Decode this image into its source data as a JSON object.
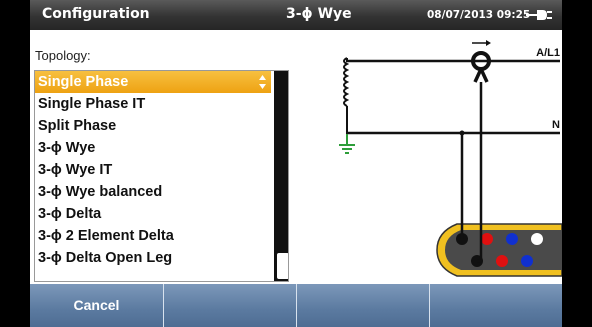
{
  "header": {
    "title": "Configuration",
    "mode": "3-ϕ Wye",
    "datetime": "08/07/2013 09:25",
    "power_icon": "plug-icon"
  },
  "topology": {
    "label": "Topology:",
    "selected_index": 0,
    "items": [
      "Single Phase",
      "Single Phase IT",
      "Split Phase",
      "3-ϕ Wye",
      "3-ϕ Wye IT",
      "3-ϕ Wye balanced",
      "3-ϕ Delta",
      "3-ϕ 2 Element Delta",
      "3-ϕ Delta Open Leg"
    ]
  },
  "diagram": {
    "line_label": "A/L1",
    "neutral_label": "N"
  },
  "softkeys": [
    "Cancel",
    "",
    "",
    ""
  ],
  "colors": {
    "selected_item": "#f0a820",
    "softkey_bar": "#5b7aa0",
    "title_bar": "#333333",
    "meter_body": "#f0c020",
    "ground": "#2e9e3a"
  }
}
